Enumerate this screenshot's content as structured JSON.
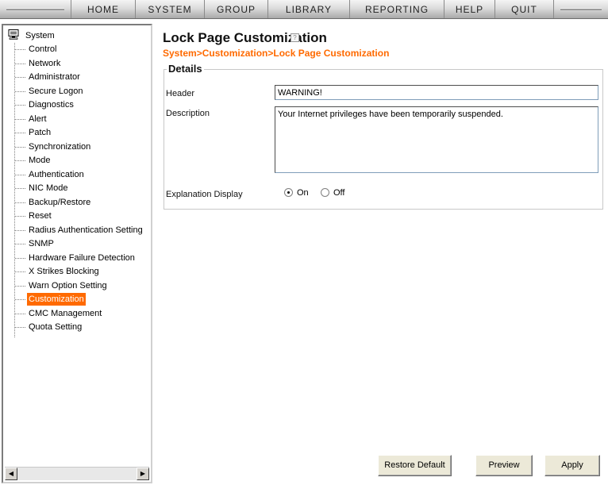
{
  "menu": {
    "items": [
      "HOME",
      "SYSTEM",
      "GROUP",
      "LIBRARY",
      "REPORTING",
      "HELP",
      "QUIT"
    ]
  },
  "tree": {
    "root": "System",
    "selected": "Customization",
    "items": [
      "Control",
      "Network",
      "Administrator",
      "Secure Logon",
      "Diagnostics",
      "Alert",
      "Patch",
      "Synchronization",
      "Mode",
      "Authentication",
      "NIC Mode",
      "Backup/Restore",
      "Reset",
      "Radius Authentication Setting",
      "SNMP",
      "Hardware Failure Detection",
      "X Strikes Blocking",
      "Warn Option Setting",
      "Customization",
      "CMC Management",
      "Quota Setting"
    ]
  },
  "page": {
    "title": "Lock Page Customization",
    "breadcrumb": "System>Customization>Lock Page Customization"
  },
  "details": {
    "legend": "Details",
    "header_label": "Header",
    "header_value": "WARNING!",
    "description_label": "Description",
    "description_value": "Your Internet privileges have been temporarily suspended.",
    "explanation_label": "Explanation Display",
    "option_on": "On",
    "option_off": "Off",
    "explanation_selected": "On"
  },
  "buttons": {
    "restore": "Restore Default",
    "preview": "Preview",
    "apply": "Apply"
  },
  "colors": {
    "accent": "#ff6a00"
  }
}
